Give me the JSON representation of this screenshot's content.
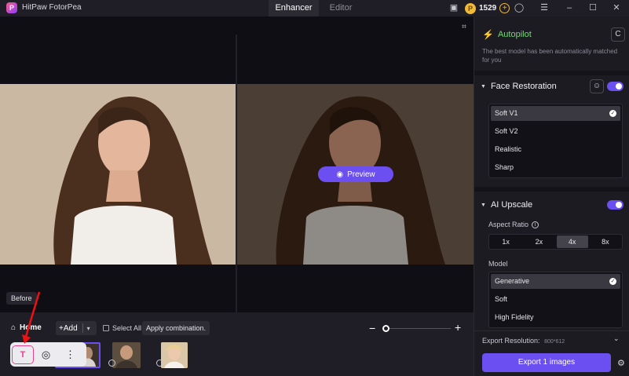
{
  "app": {
    "logo_letter": "P",
    "title": "HitPaw FotorPea"
  },
  "tabs": [
    {
      "label": "Enhancer"
    },
    {
      "label": "Editor"
    }
  ],
  "credits": {
    "count": "1529"
  },
  "canvas": {
    "before_label": "Before",
    "preview_label": "Preview"
  },
  "bottom": {
    "home_label": "Home",
    "add_label": "Add",
    "select_all_label": "Select All",
    "apply_label": "Apply combination."
  },
  "panel": {
    "autopilot": {
      "title": "Autopilot",
      "note": "The best model has been automatically matched for you"
    },
    "face_restoration": {
      "title": "Face Restoration",
      "enabled": true,
      "options": [
        "Soft V1",
        "Soft V2",
        "Realistic",
        "Sharp"
      ],
      "selected": "Soft V1"
    },
    "ai_upscale": {
      "title": "AI Upscale",
      "enabled": true,
      "aspect_label": "Aspect Ratio",
      "ratios": [
        "1x",
        "2x",
        "4x",
        "8x"
      ],
      "selected_ratio": "4x",
      "model_label": "Model",
      "models": [
        "Generative",
        "Soft",
        "High Fidelity"
      ],
      "selected_model": "Generative"
    },
    "export": {
      "resolution_label": "Export Resolution:",
      "resolution_value": "800*612",
      "button_label": "Export 1 images"
    }
  },
  "colors": {
    "accent": "#6c4ff0",
    "autopilot_green": "#5ac35f",
    "coin": "#f0b93a"
  }
}
